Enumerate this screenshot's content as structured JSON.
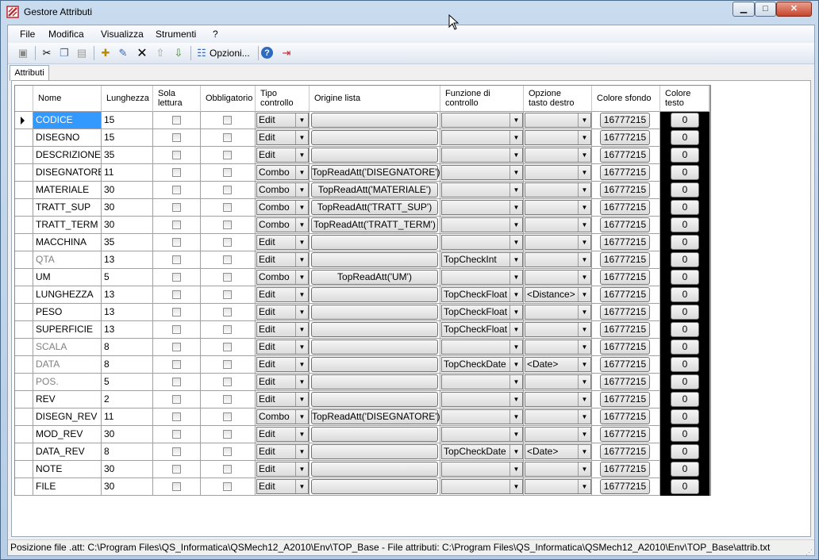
{
  "window": {
    "title": "Gestore Attributi"
  },
  "menu": [
    "File",
    "Modifica",
    "Visualizza",
    "Strumenti",
    "?"
  ],
  "toolbar": {
    "options_label": "Opzioni..."
  },
  "tabs": [
    "Attributi"
  ],
  "columns": {
    "nome": "Nome",
    "lunghezza": "Lunghezza",
    "sola_lettura": "Sola lettura",
    "obbligatorio": "Obbligatorio",
    "tipo_controllo": "Tipo controllo",
    "origine_lista": "Origine lista",
    "funzione_controllo": "Funzione di controllo",
    "opzione_tasto_destro": "Opzione tasto destro",
    "colore_sfondo": "Colore sfondo",
    "colore_testo": "Colore testo"
  },
  "rows": [
    {
      "nome": "CODICE",
      "lun": "15",
      "tipo": "Edit",
      "origine": "",
      "funz": "",
      "opz": "",
      "sfondo": "16777215",
      "testo": "0",
      "gray": false,
      "selected": true
    },
    {
      "nome": "DISEGNO",
      "lun": "15",
      "tipo": "Edit",
      "origine": "",
      "funz": "",
      "opz": "",
      "sfondo": "16777215",
      "testo": "0",
      "gray": false
    },
    {
      "nome": "DESCRIZIONE",
      "lun": "35",
      "tipo": "Edit",
      "origine": "",
      "funz": "",
      "opz": "",
      "sfondo": "16777215",
      "testo": "0",
      "gray": false
    },
    {
      "nome": "DISEGNATORE",
      "lun": "11",
      "tipo": "Combo",
      "origine": "TopReadAtt('DISEGNATORE')",
      "funz": "",
      "opz": "",
      "sfondo": "16777215",
      "testo": "0",
      "gray": false
    },
    {
      "nome": "MATERIALE",
      "lun": "30",
      "tipo": "Combo",
      "origine": "TopReadAtt('MATERIALE')",
      "funz": "",
      "opz": "",
      "sfondo": "16777215",
      "testo": "0",
      "gray": false
    },
    {
      "nome": "TRATT_SUP",
      "lun": "30",
      "tipo": "Combo",
      "origine": "TopReadAtt('TRATT_SUP')",
      "funz": "",
      "opz": "",
      "sfondo": "16777215",
      "testo": "0",
      "gray": false
    },
    {
      "nome": "TRATT_TERM",
      "lun": "30",
      "tipo": "Combo",
      "origine": "TopReadAtt('TRATT_TERM')",
      "funz": "",
      "opz": "",
      "sfondo": "16777215",
      "testo": "0",
      "gray": false
    },
    {
      "nome": "MACCHINA",
      "lun": "35",
      "tipo": "Edit",
      "origine": "",
      "funz": "",
      "opz": "",
      "sfondo": "16777215",
      "testo": "0",
      "gray": false
    },
    {
      "nome": "QTA",
      "lun": "13",
      "tipo": "Edit",
      "origine": "",
      "funz": "TopCheckInt",
      "opz": "",
      "sfondo": "16777215",
      "testo": "0",
      "gray": true
    },
    {
      "nome": "UM",
      "lun": "5",
      "tipo": "Combo",
      "origine": "TopReadAtt('UM')",
      "funz": "",
      "opz": "",
      "sfondo": "16777215",
      "testo": "0",
      "gray": false
    },
    {
      "nome": "LUNGHEZZA",
      "lun": "13",
      "tipo": "Edit",
      "origine": "",
      "funz": "TopCheckFloat",
      "opz": "<Distance>",
      "sfondo": "16777215",
      "testo": "0",
      "gray": false
    },
    {
      "nome": "PESO",
      "lun": "13",
      "tipo": "Edit",
      "origine": "",
      "funz": "TopCheckFloat",
      "opz": "",
      "sfondo": "16777215",
      "testo": "0",
      "gray": false
    },
    {
      "nome": "SUPERFICIE",
      "lun": "13",
      "tipo": "Edit",
      "origine": "",
      "funz": "TopCheckFloat",
      "opz": "",
      "sfondo": "16777215",
      "testo": "0",
      "gray": false
    },
    {
      "nome": "SCALA",
      "lun": "8",
      "tipo": "Edit",
      "origine": "",
      "funz": "",
      "opz": "",
      "sfondo": "16777215",
      "testo": "0",
      "gray": true
    },
    {
      "nome": "DATA",
      "lun": "8",
      "tipo": "Edit",
      "origine": "",
      "funz": "TopCheckDate",
      "opz": "<Date>",
      "sfondo": "16777215",
      "testo": "0",
      "gray": true
    },
    {
      "nome": "POS.",
      "lun": "5",
      "tipo": "Edit",
      "origine": "",
      "funz": "",
      "opz": "",
      "sfondo": "16777215",
      "testo": "0",
      "gray": true
    },
    {
      "nome": "REV",
      "lun": "2",
      "tipo": "Edit",
      "origine": "",
      "funz": "",
      "opz": "",
      "sfondo": "16777215",
      "testo": "0",
      "gray": false
    },
    {
      "nome": "DISEGN_REV",
      "lun": "11",
      "tipo": "Combo",
      "origine": "TopReadAtt('DISEGNATORE')",
      "funz": "",
      "opz": "",
      "sfondo": "16777215",
      "testo": "0",
      "gray": false
    },
    {
      "nome": "MOD_REV",
      "lun": "30",
      "tipo": "Edit",
      "origine": "",
      "funz": "",
      "opz": "",
      "sfondo": "16777215",
      "testo": "0",
      "gray": false
    },
    {
      "nome": "DATA_REV",
      "lun": "8",
      "tipo": "Edit",
      "origine": "",
      "funz": "TopCheckDate",
      "opz": "<Date>",
      "sfondo": "16777215",
      "testo": "0",
      "gray": false
    },
    {
      "nome": "NOTE",
      "lun": "30",
      "tipo": "Edit",
      "origine": "",
      "funz": "",
      "opz": "",
      "sfondo": "16777215",
      "testo": "0",
      "gray": false
    },
    {
      "nome": "FILE",
      "lun": "30",
      "tipo": "Edit",
      "origine": "",
      "funz": "",
      "opz": "",
      "sfondo": "16777215",
      "testo": "0",
      "gray": false
    }
  ],
  "status": {
    "text": "Posizione file .att: C:\\Program Files\\QS_Informatica\\QSMech12_A2010\\Env\\TOP_Base  -  File attributi: C:\\Program Files\\QS_Informatica\\QSMech12_A2010\\Env\\TOP_Base\\attrib.txt"
  }
}
